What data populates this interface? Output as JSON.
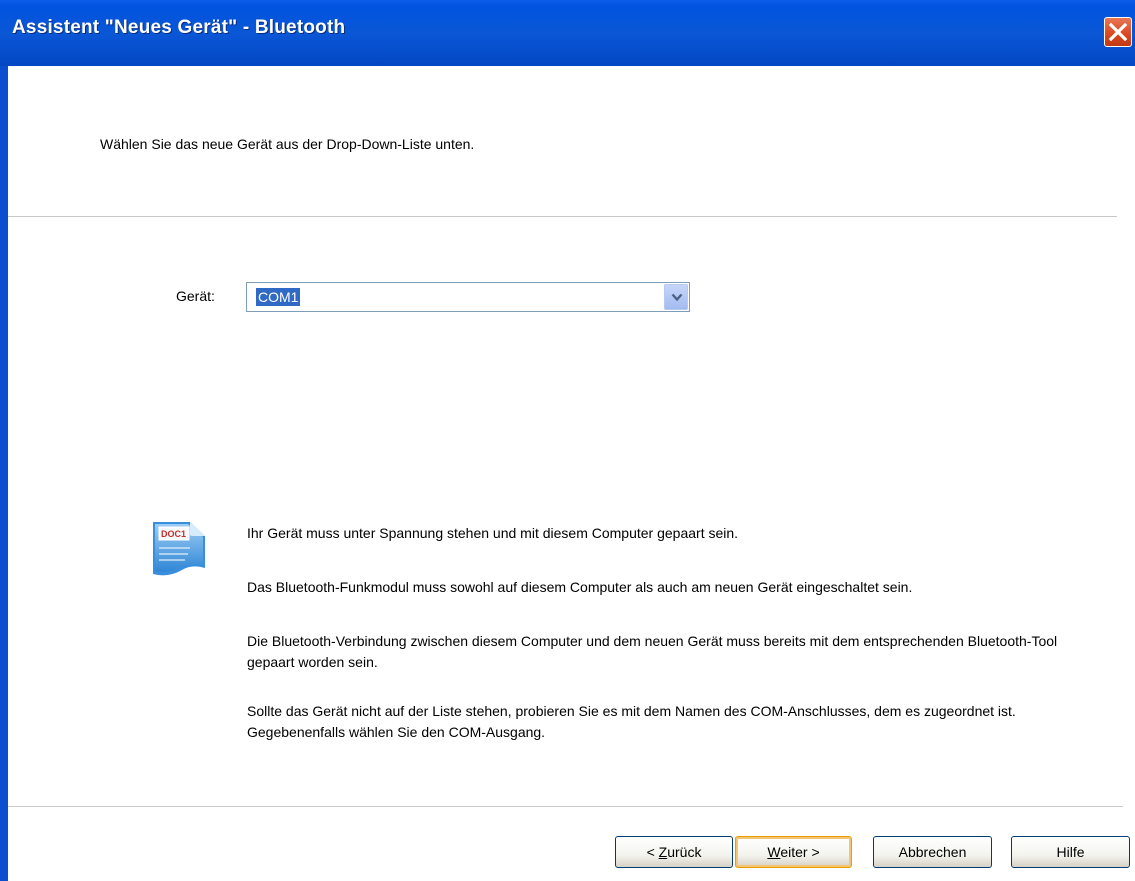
{
  "window": {
    "title": "Assistent \"Neues Gerät\" - Bluetooth"
  },
  "instruction": "Wählen Sie das neue Gerät aus der Drop-Down-Liste unten.",
  "device": {
    "label": "Gerät:",
    "selected": "COM1"
  },
  "icon": {
    "name": "doc-icon",
    "label": "DOC1"
  },
  "info": [
    "Ihr Gerät muss unter Spannung stehen und mit diesem Computer gepaart sein.",
    "Das Bluetooth-Funkmodul muss sowohl auf diesem Computer als auch am neuen Gerät eingeschaltet sein.",
    "Die Bluetooth-Verbindung zwischen diesem Computer und dem neuen Gerät muss bereits mit dem entsprechenden Bluetooth-Tool gepaart worden sein.",
    "Sollte das Gerät nicht auf der Liste stehen, probieren Sie es mit dem Namen des COM-Anschlusses, dem es zugeordnet ist. Gegebenenfalls wählen Sie den COM-Ausgang."
  ],
  "buttons": {
    "back": {
      "prefix": "< ",
      "mnemonic": "Z",
      "rest": "urück"
    },
    "next": {
      "mnemonic": "W",
      "rest": "eiter >"
    },
    "cancel": "Abbrechen",
    "help": "Hilfe"
  },
  "colors": {
    "titlebar": "#0153e0",
    "selection": "#316ac5",
    "close": "#d9471e"
  }
}
